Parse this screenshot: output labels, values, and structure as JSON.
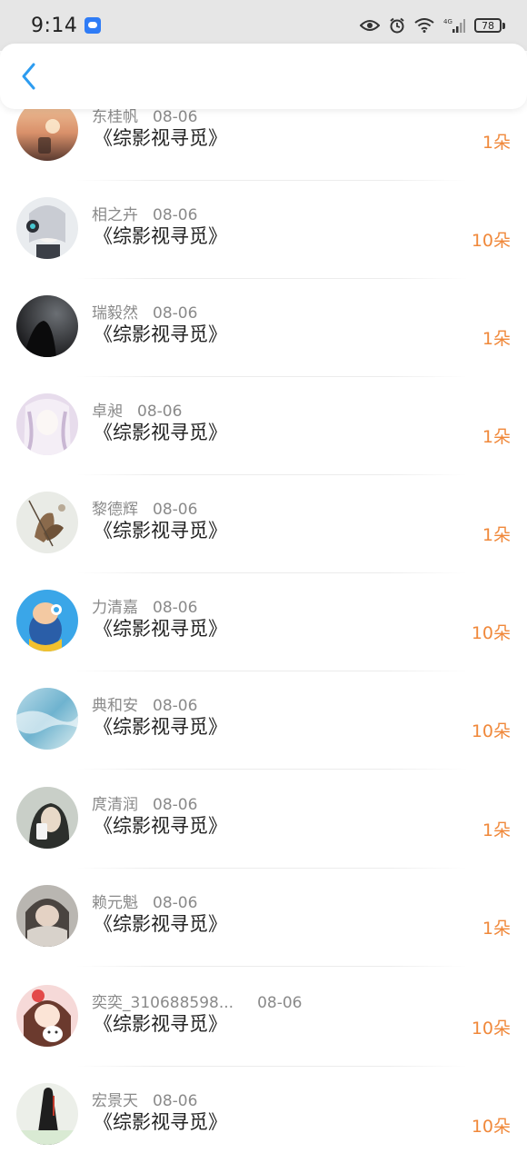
{
  "status_bar": {
    "time": "9:14",
    "battery": "78"
  },
  "colors": {
    "accent_blue": "#2d9cf0",
    "amount_orange": "#f0883a",
    "meta_gray": "#8a8a8a"
  },
  "header": {
    "back_icon": "chevron-left-icon"
  },
  "list": {
    "rows": [
      {
        "name": "东桂帆",
        "date": "08-06",
        "title": "《综影视寻觅》",
        "amount": "1朵"
      },
      {
        "name": "相之卉",
        "date": "08-06",
        "title": "《综影视寻觅》",
        "amount": "10朵"
      },
      {
        "name": "瑞毅然",
        "date": "08-06",
        "title": "《综影视寻觅》",
        "amount": "1朵"
      },
      {
        "name": "卓昶",
        "date": "08-06",
        "title": "《综影视寻觅》",
        "amount": "1朵"
      },
      {
        "name": "黎德辉",
        "date": "08-06",
        "title": "《综影视寻觅》",
        "amount": "1朵"
      },
      {
        "name": "力清嘉",
        "date": "08-06",
        "title": "《综影视寻觅》",
        "amount": "10朵"
      },
      {
        "name": "典和安",
        "date": "08-06",
        "title": "《综影视寻觅》",
        "amount": "10朵"
      },
      {
        "name": "庹清润",
        "date": "08-06",
        "title": "《综影视寻觅》",
        "amount": "1朵"
      },
      {
        "name": "赖元魁",
        "date": "08-06",
        "title": "《综影视寻觅》",
        "amount": "1朵"
      },
      {
        "name": "奕奕_310688598...",
        "date": "08-06",
        "title": "《综影视寻觅》",
        "amount": "10朵"
      },
      {
        "name": "宏景天",
        "date": "08-06",
        "title": "《综影视寻觅》",
        "amount": "10朵"
      }
    ]
  }
}
